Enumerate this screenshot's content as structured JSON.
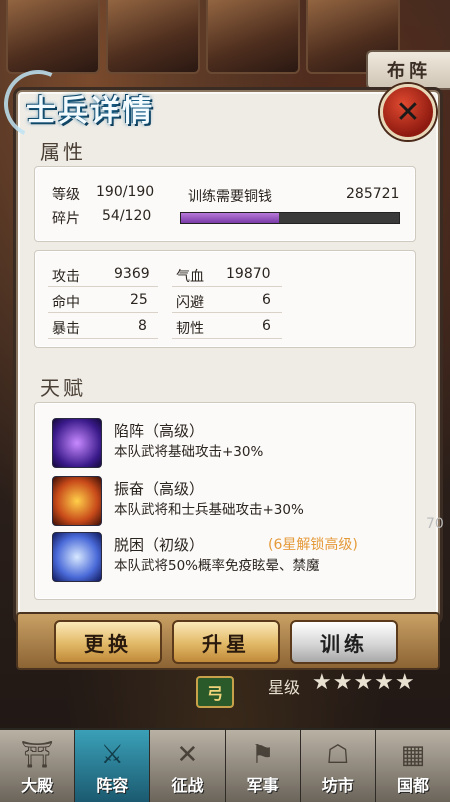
{
  "header": {
    "formation_tab": "布阵",
    "panel_title": "士兵详情",
    "close_icon": "close-x-icon"
  },
  "attributes": {
    "section_title": "属性",
    "level_label": "等级",
    "level_value": "190/190",
    "fragments_label": "碎片",
    "fragments_value": "54/120",
    "training_cost_label": "训练需要铜钱",
    "training_cost_value": "285721",
    "training_progress": 0.45
  },
  "stats": [
    {
      "label": "攻击",
      "value": "9369"
    },
    {
      "label": "气血",
      "value": "19870"
    },
    {
      "label": "命中",
      "value": "25"
    },
    {
      "label": "闪避",
      "value": "6"
    },
    {
      "label": "暴击",
      "value": "8"
    },
    {
      "label": "韧性",
      "value": "6"
    }
  ],
  "talents": {
    "section_title": "天赋",
    "items": [
      {
        "name": "陷阵（高级）",
        "desc": "本队武将基础攻击+30%",
        "icon": "warrior-purple-icon",
        "color": "#6a3ac8"
      },
      {
        "name": "振奋（高级）",
        "desc": "本队武将和士兵基础攻击+30%",
        "icon": "warrior-fire-icon",
        "color": "#c84a1a"
      },
      {
        "name": "脱困（初级）",
        "desc": "本队武将50%概率免疫眩晕、禁魔",
        "icon": "warrior-blue-icon",
        "color": "#3a5ad8",
        "unlock_hint": "(6星解锁高级)"
      }
    ]
  },
  "actions": {
    "replace": "更换",
    "star_up": "升星",
    "train": "训练"
  },
  "star_row": {
    "weapon_badge": "弓",
    "label": "星级",
    "stars": "★★★★★"
  },
  "side_number": "70",
  "nav": [
    {
      "label": "大殿",
      "icon": "palace-icon",
      "glyph": "⛩"
    },
    {
      "label": "阵容",
      "icon": "helmet-icon",
      "glyph": "⚔",
      "active": true
    },
    {
      "label": "征战",
      "icon": "crossed-swords-icon",
      "glyph": "✕"
    },
    {
      "label": "军事",
      "icon": "flag-icon",
      "glyph": "⚑"
    },
    {
      "label": "坊市",
      "icon": "market-icon",
      "glyph": "☖"
    },
    {
      "label": "国都",
      "icon": "city-icon",
      "glyph": "▦"
    }
  ],
  "colors": {
    "progress_fill": "#9a5ac8",
    "unlock_text": "#e59a3a",
    "active_nav": "#2a8aa8"
  }
}
